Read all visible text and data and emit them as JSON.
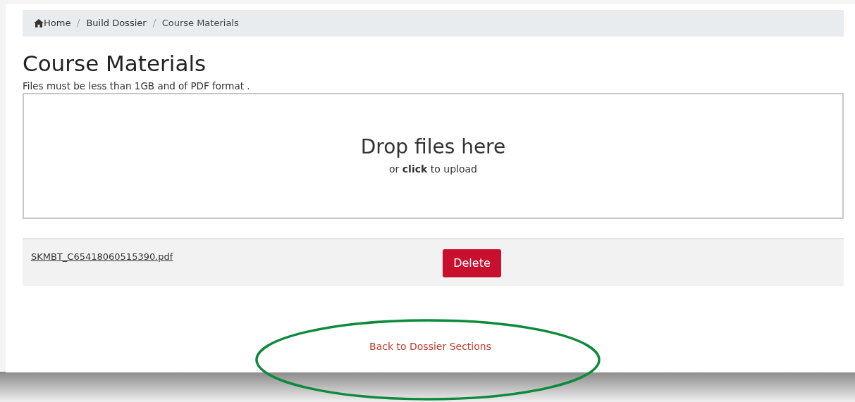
{
  "breadcrumb": [
    {
      "label": "Home",
      "kind": "home"
    },
    {
      "label": "Build Dossier",
      "kind": "link"
    },
    {
      "label": "Course Materials",
      "kind": "current"
    }
  ],
  "title": "Course Materials",
  "note": "Files must be less than 1GB and of PDF format .",
  "dropzone": {
    "heading": "Drop files here",
    "hint": "or **click** to upload"
  },
  "files": [
    {
      "name": "SKMBT_C65418060515390.pdf",
      "action": "Delete"
    }
  ],
  "back_link": "Back to Dossier Sections",
  "annotation": {
    "kind": "ellipse",
    "color": "#0e8a3c"
  }
}
